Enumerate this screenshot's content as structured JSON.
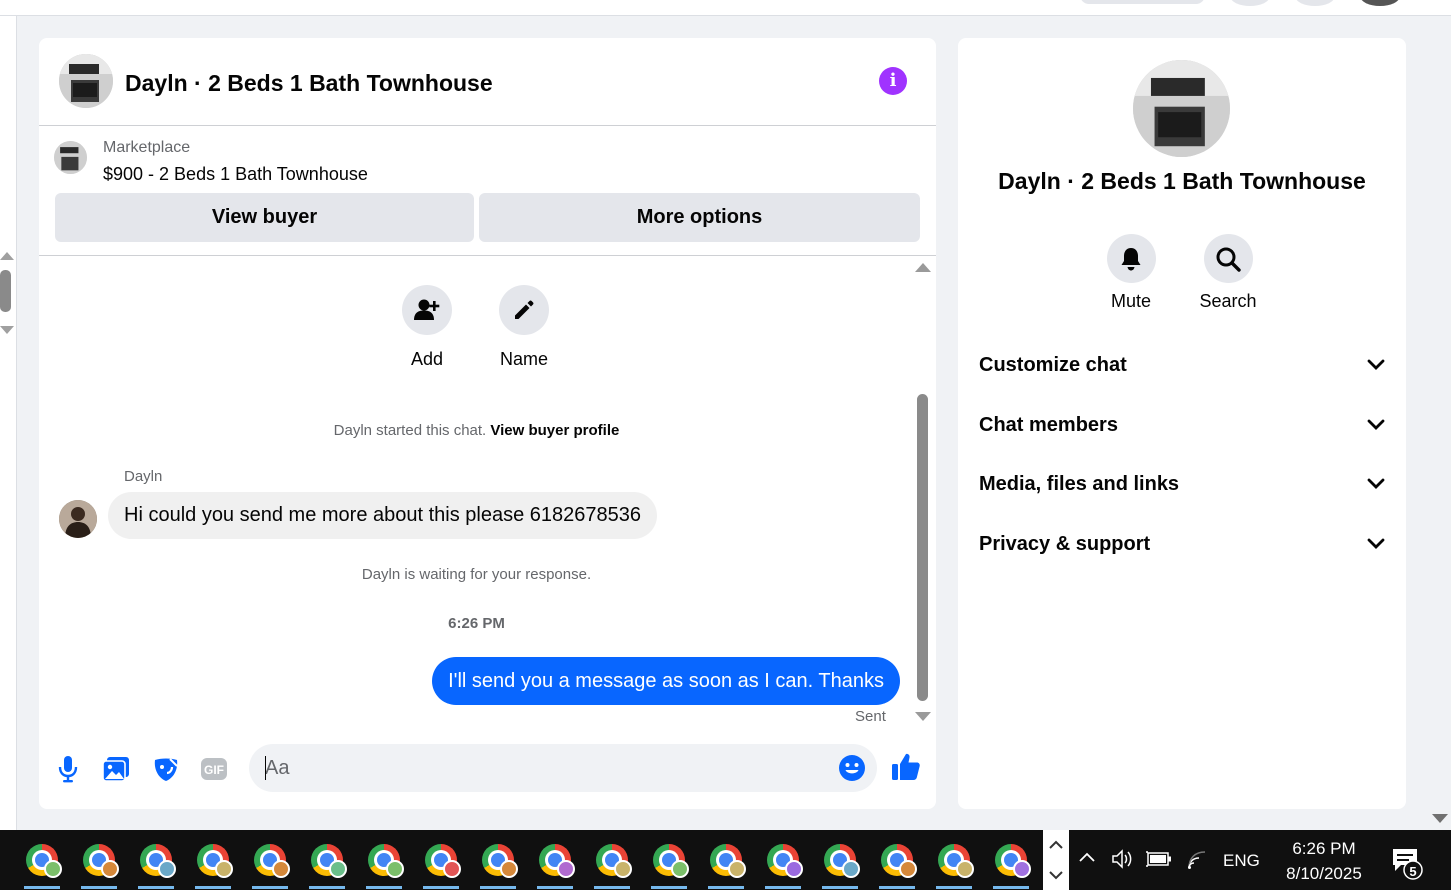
{
  "chat": {
    "title": "Dayln · 2 Beds 1 Bath Townhouse",
    "marketplace_label": "Marketplace",
    "listing": "$900 - 2 Beds 1 Bath Townhouse",
    "view_buyer_label": "View buyer",
    "more_options_label": "More options",
    "actions": [
      {
        "label": "Add",
        "icon": "add-person-icon"
      },
      {
        "label": "Name",
        "icon": "pencil-icon"
      }
    ],
    "started_text": "Dayln started this chat.",
    "view_profile_link": "View buyer profile",
    "sender_name": "Dayln",
    "incoming_message": "Hi could you send me more about this please 6182678536",
    "waiting_text": "Dayln is waiting for your response.",
    "timestamp": "6:26 PM",
    "outgoing_message": "I'll send you a message as soon as I can. Thanks",
    "sent_status": "Sent",
    "composer_placeholder": "Aa"
  },
  "side": {
    "title": "Dayln · 2 Beds 1 Bath Townhouse",
    "actions": [
      {
        "label": "Mute",
        "icon": "bell-icon"
      },
      {
        "label": "Search",
        "icon": "search-icon"
      }
    ],
    "sections": [
      {
        "label": "Customize chat"
      },
      {
        "label": "Chat members"
      },
      {
        "label": "Media, files and links"
      },
      {
        "label": "Privacy & support"
      }
    ]
  },
  "taskbar": {
    "language": "ENG",
    "time": "6:26 PM",
    "date": "8/10/2025",
    "notification_count": "5"
  },
  "colors": {
    "accent_blue": "#0866ff",
    "info_purple": "#a033ff",
    "bubble_gray": "#f0f0f0",
    "button_gray": "#e4e6eb"
  }
}
